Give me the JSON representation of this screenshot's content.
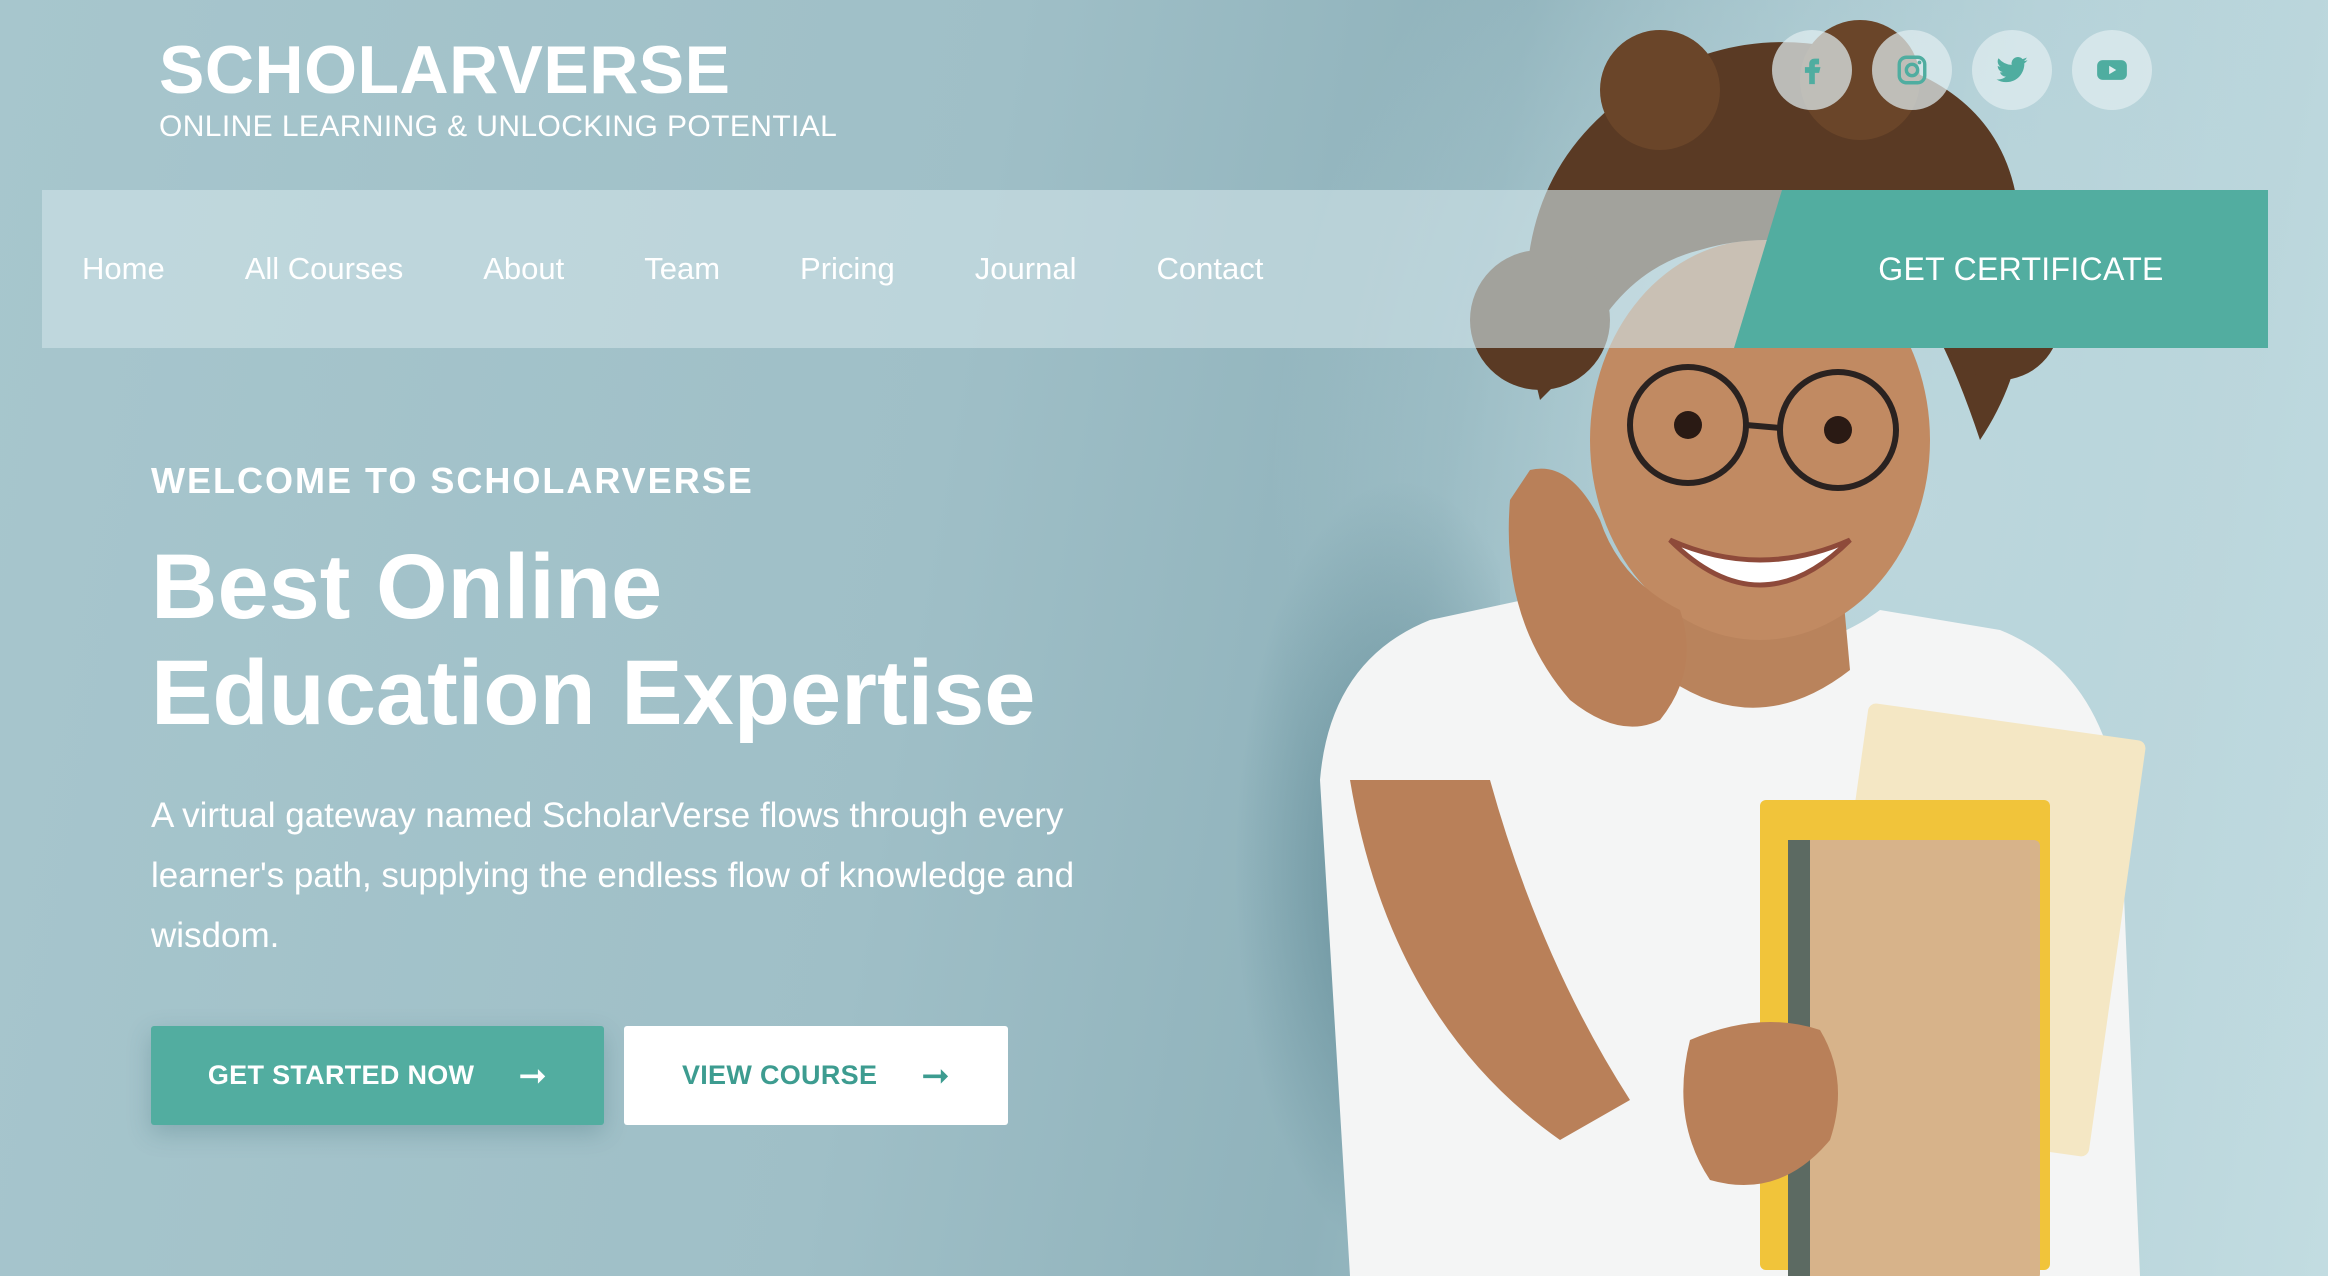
{
  "brand": {
    "title": "SCHOLARVERSE",
    "tagline": "ONLINE LEARNING & UNLOCKING POTENTIAL"
  },
  "social": [
    {
      "icon": "facebook-icon"
    },
    {
      "icon": "instagram-icon"
    },
    {
      "icon": "twitter-icon"
    },
    {
      "icon": "youtube-icon"
    }
  ],
  "nav": {
    "items": [
      "Home",
      "All Courses",
      "About",
      "Team",
      "Pricing",
      "Journal",
      "Contact"
    ],
    "cta": "GET CERTIFICATE"
  },
  "hero": {
    "welcome": "WELCOME TO SCHOLARVERSE",
    "headline": "Best Online Education Expertise",
    "description": "A virtual gateway named ScholarVerse flows through every learner's path, supplying the endless flow of knowledge and wisdom.",
    "primary_button": "GET STARTED NOW",
    "secondary_button": "VIEW COURSE"
  },
  "colors": {
    "accent": "#52ada0",
    "background": "#a9c8cf",
    "text": "#ffffff"
  }
}
